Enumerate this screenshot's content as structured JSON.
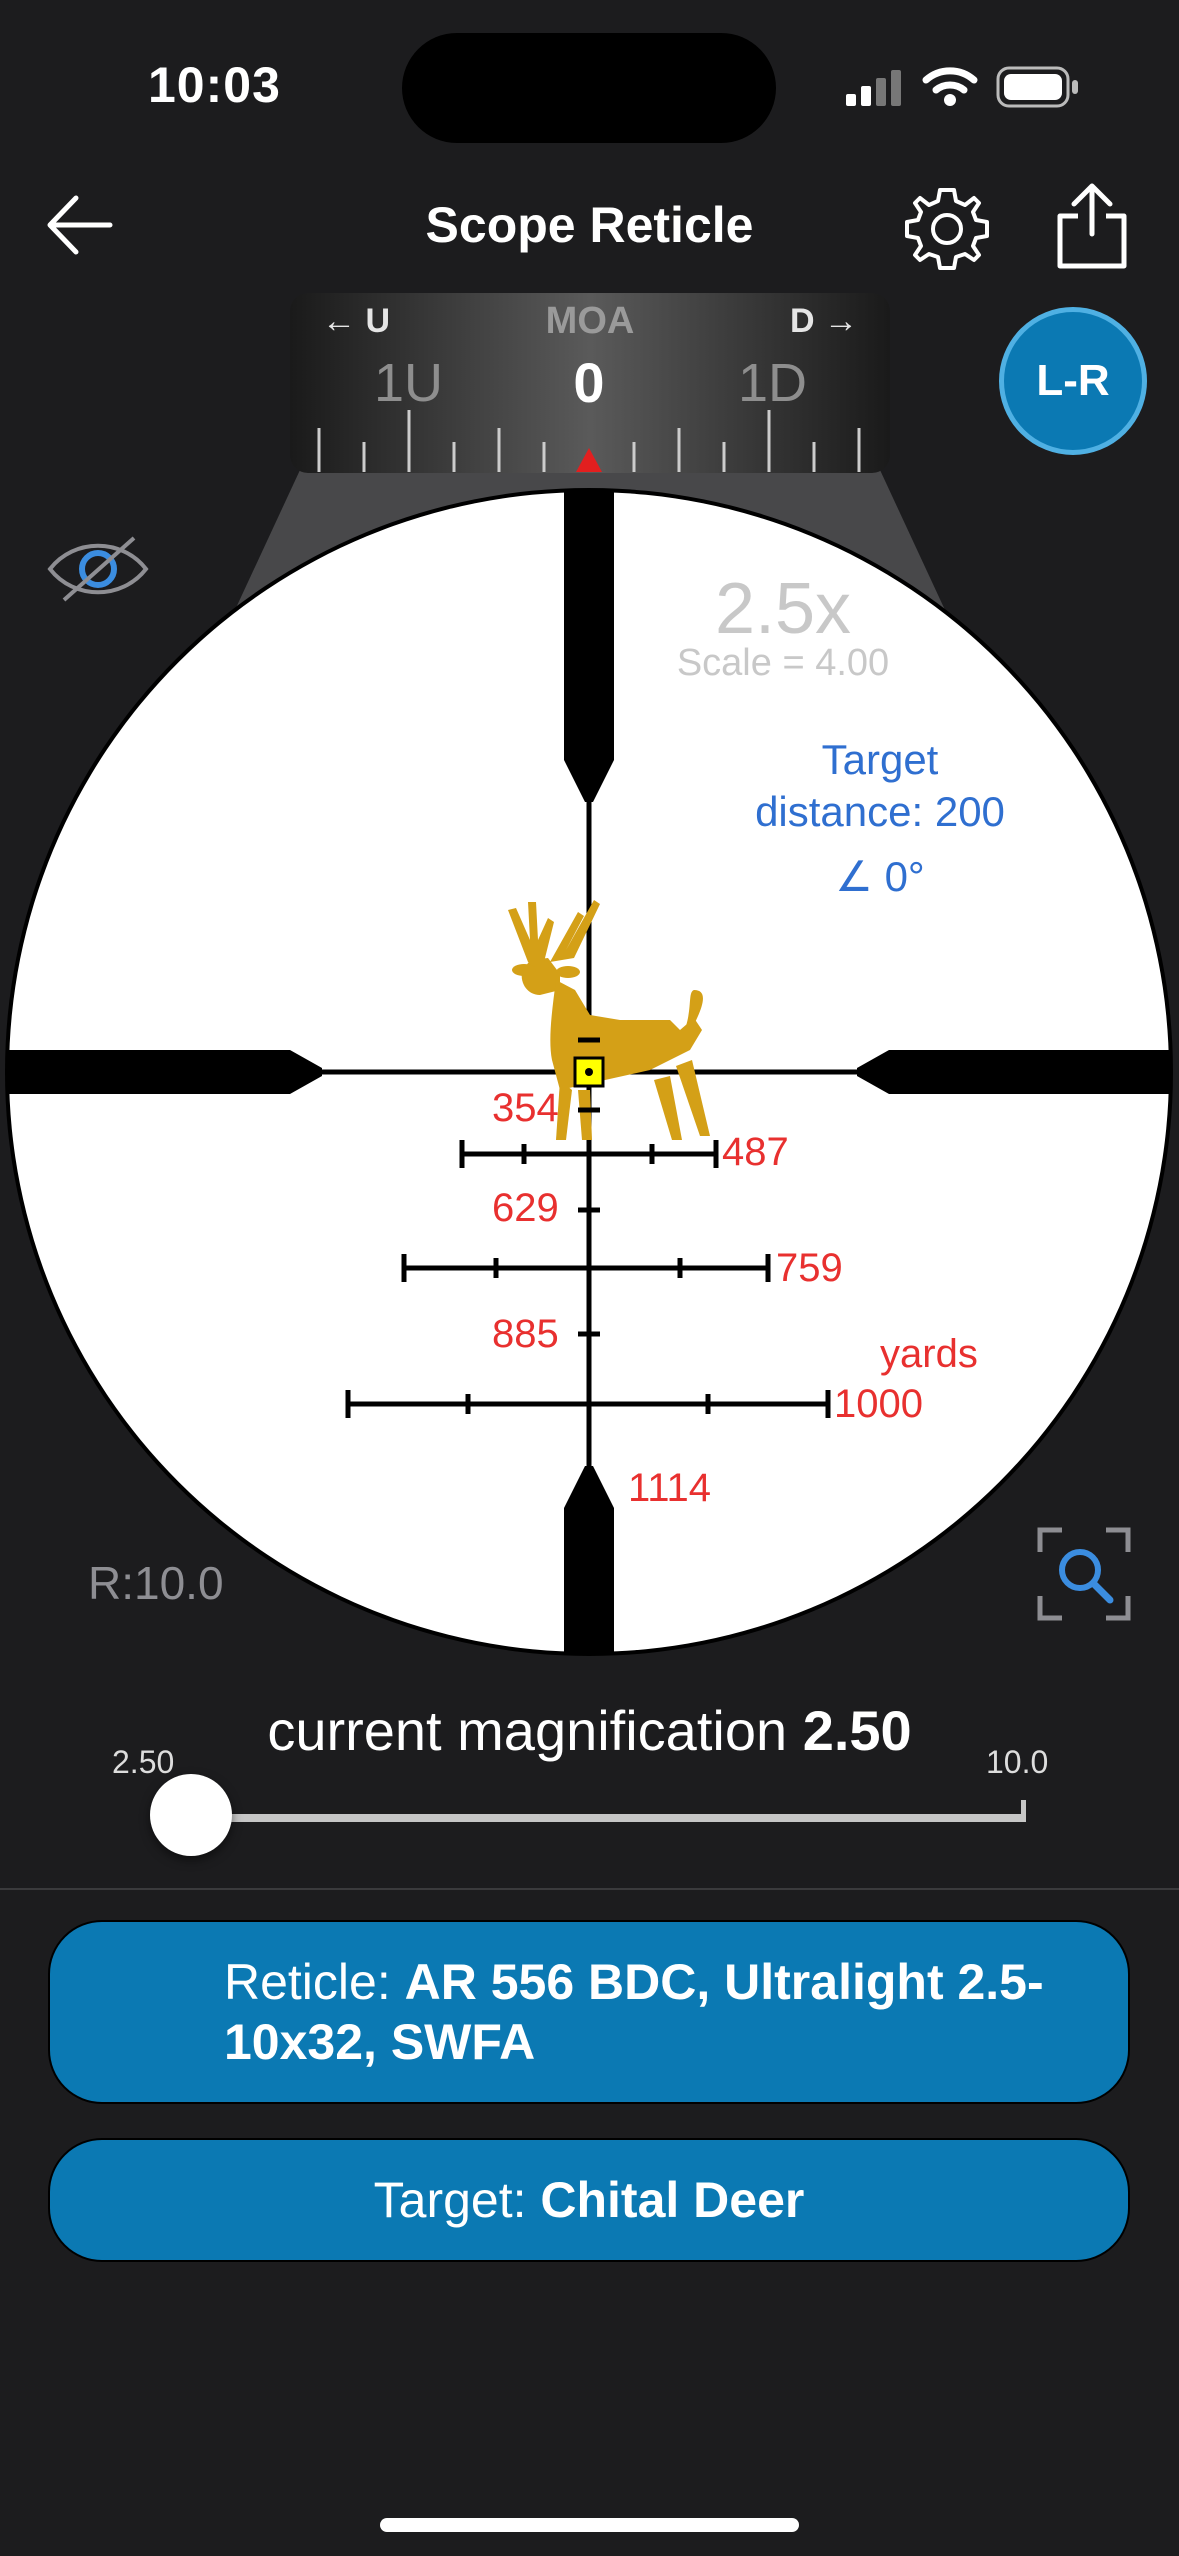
{
  "status_bar": {
    "time": "10:03"
  },
  "nav": {
    "title": "Scope Reticle"
  },
  "turret": {
    "left": "← U",
    "unit": "MOA",
    "right": "D →",
    "tick_left": "1U",
    "tick_center": "0",
    "tick_right": "1D"
  },
  "toggle": {
    "label": "L-R"
  },
  "scope": {
    "power": "2.5x",
    "scale": "Scale = 4.00",
    "target_line1": "Target",
    "target_line2": "distance: 200",
    "angle": "∠ 0°",
    "range_labels": [
      "354",
      "487",
      "629",
      "759",
      "885",
      "1000",
      "1114"
    ],
    "units": "yards",
    "reticle_range": "R:10.0"
  },
  "magnification": {
    "label": "current magnification",
    "value": "2.50",
    "min": "2.50",
    "max": "10.0",
    "slider_fraction": 0
  },
  "reticle_button": {
    "prefix": "Reticle: ",
    "name": "AR 556 BDC, Ultralight 2.5-10x32, SWFA"
  },
  "target_button": {
    "prefix": "Target: ",
    "name": "Chital Deer"
  },
  "colors": {
    "accent": "#0b79b3",
    "ranges": "#e8302f",
    "target_text": "#2f6fd0",
    "deer": "#d4a017",
    "aim_point": "#ffff00"
  },
  "icons": [
    "back-arrow-icon",
    "gear-icon",
    "share-icon",
    "hide-eye-icon",
    "zoom-search-icon",
    "signal-icon",
    "wifi-icon",
    "battery-icon"
  ]
}
